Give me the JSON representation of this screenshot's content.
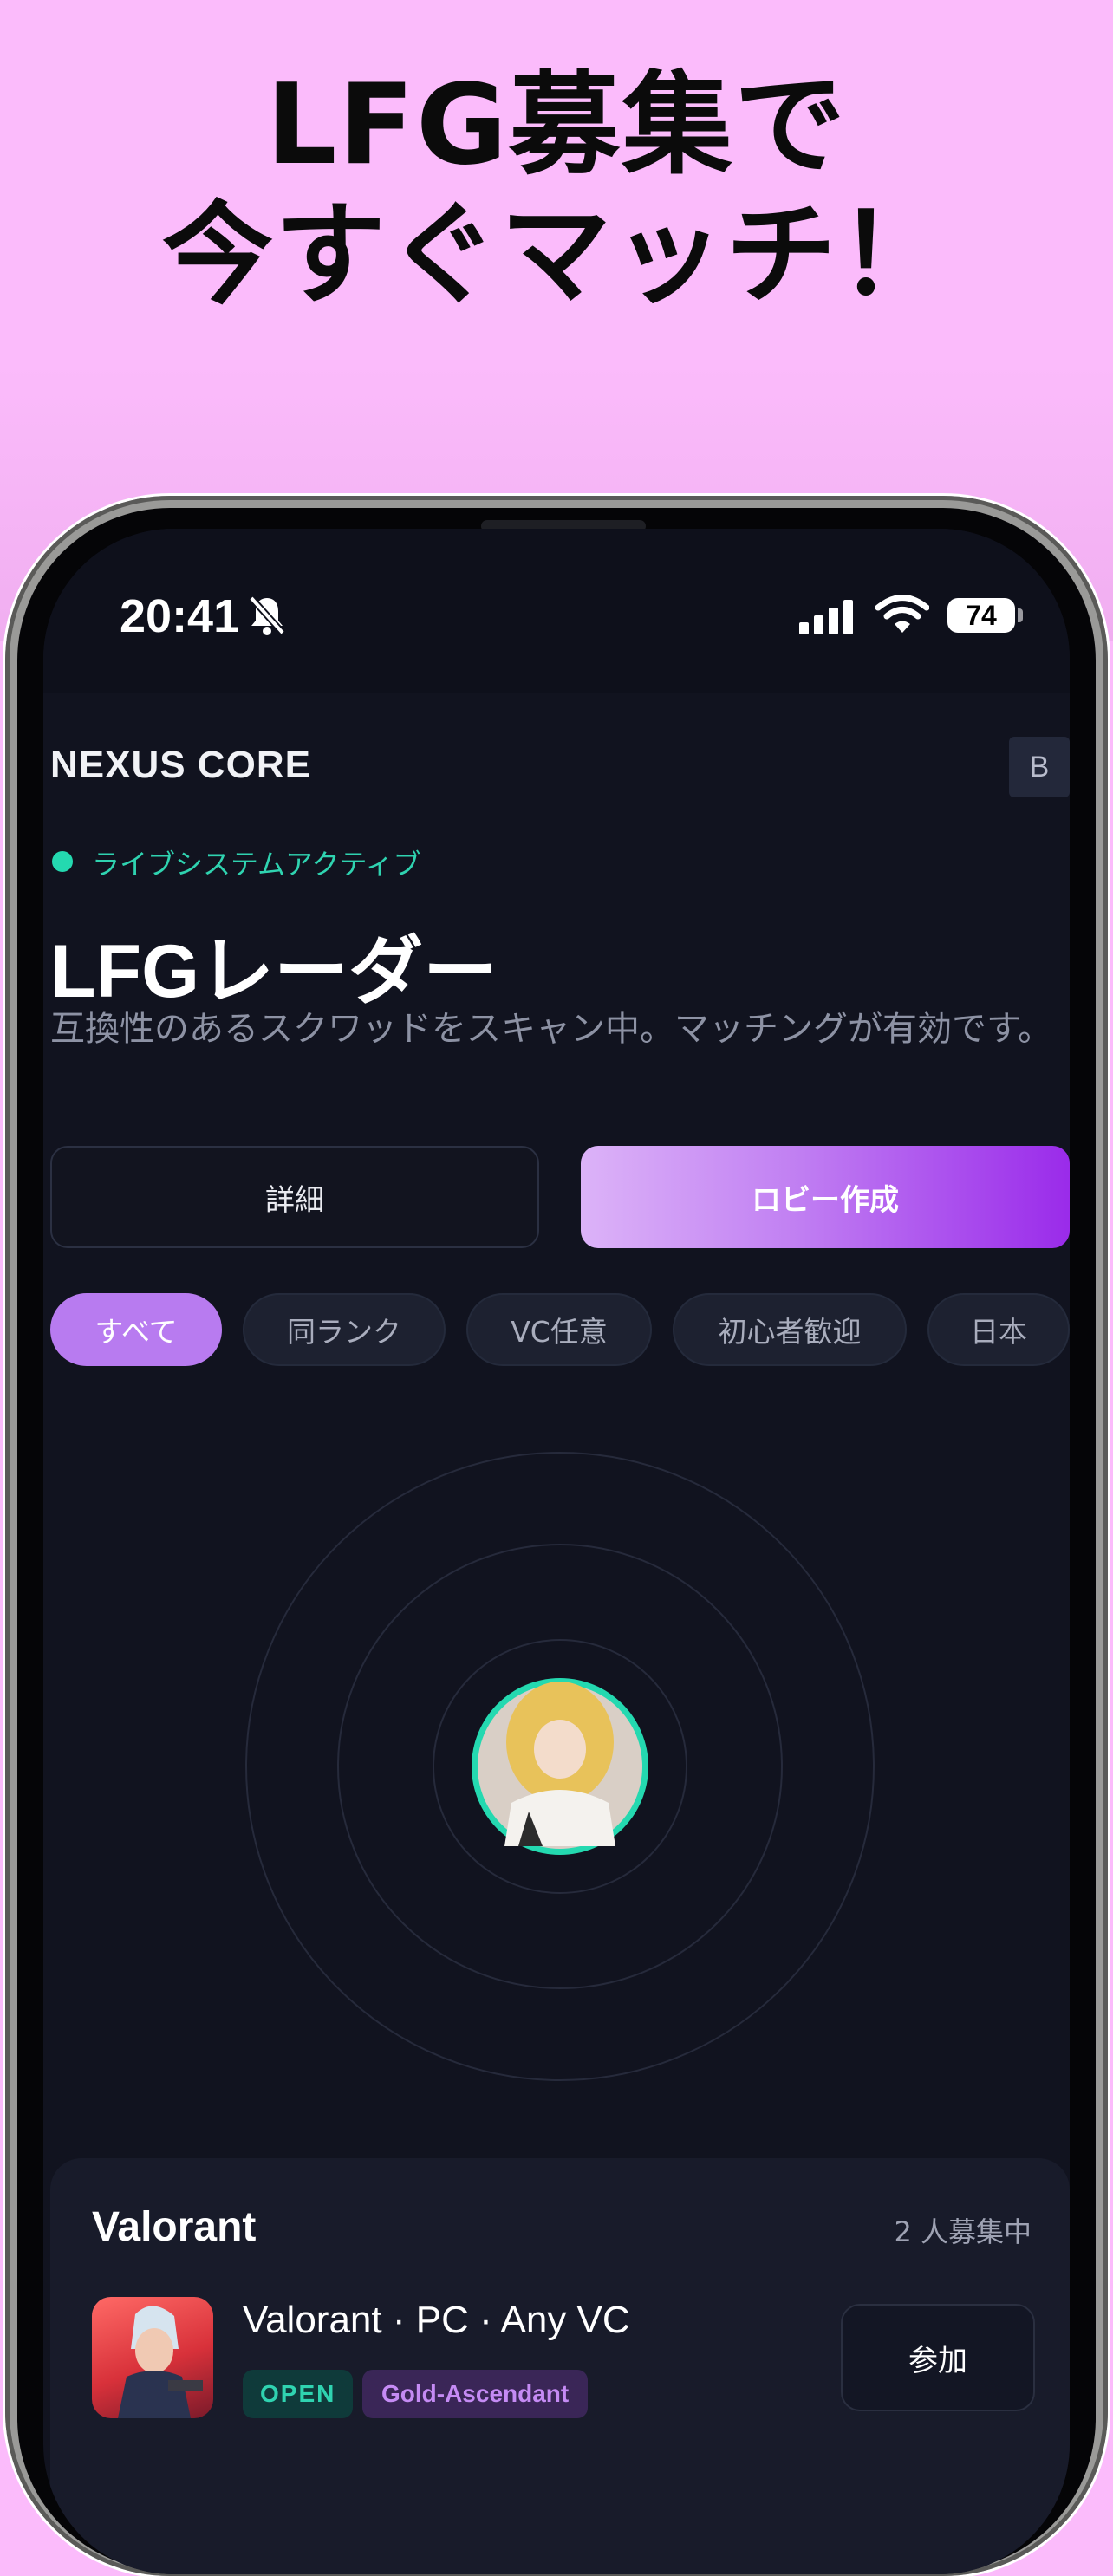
{
  "promo": {
    "line1": "LFG募集で",
    "line2": "今すぐマッチ！"
  },
  "status_bar": {
    "time": "20:41",
    "battery": "74"
  },
  "header": {
    "app_name": "NEXUS CORE",
    "avatar_initial": "B"
  },
  "hero": {
    "status_label": "ライブシステムアクティブ",
    "title": "LFGレーダー",
    "subtitle": "互換性のあるスクワッドをスキャン中。マッチングが有効です。"
  },
  "actions": {
    "details_label": "詳細",
    "create_lobby_label": "ロビー作成"
  },
  "filters": [
    {
      "label": "すべて",
      "active": true
    },
    {
      "label": "同ランク",
      "active": false
    },
    {
      "label": "VC任意",
      "active": false
    },
    {
      "label": "初心者歓迎",
      "active": false
    },
    {
      "label": "日本",
      "active": false
    }
  ],
  "lobby_card": {
    "game": "Valorant",
    "recruiting": "2 人募集中",
    "details": "Valorant · PC · Any VC",
    "status_tag": "OPEN",
    "rank_tag": "Gold-Ascendant",
    "join_label": "参加"
  },
  "colors": {
    "accent": "#b87bf0",
    "live": "#24d9b0",
    "background": "#11131f",
    "promo_bg": "#fbbbfb"
  }
}
